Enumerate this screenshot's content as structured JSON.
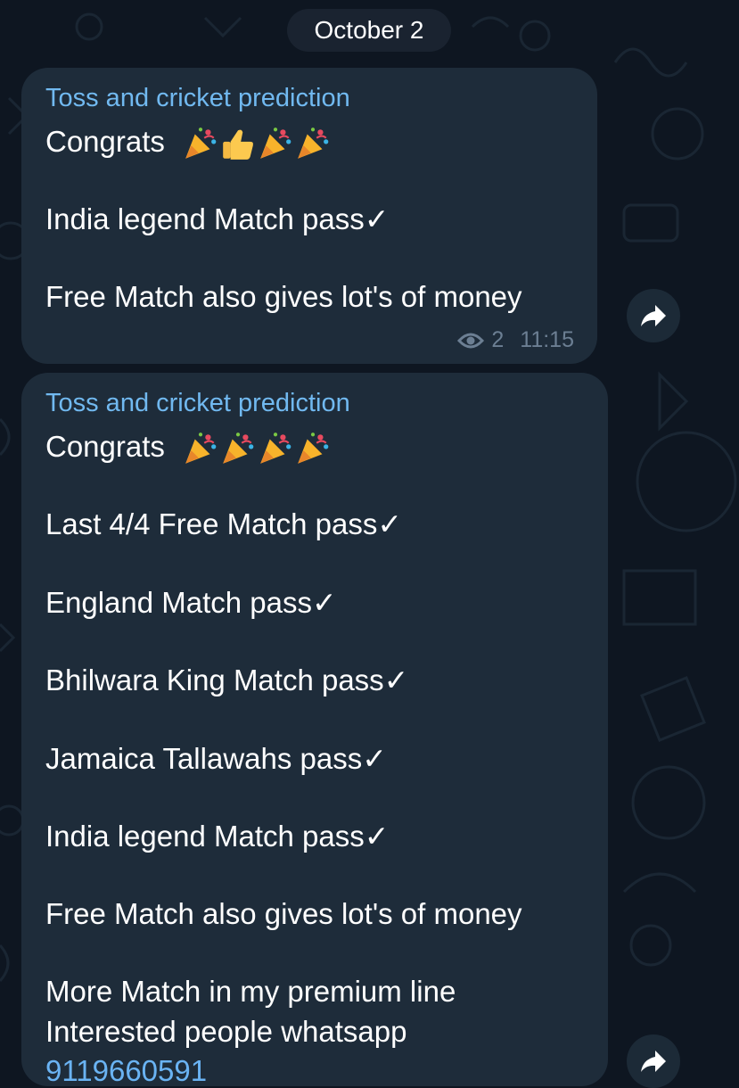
{
  "date_separator": "October 2",
  "messages": [
    {
      "sender": "Toss and cricket prediction",
      "congrats": "Congrats",
      "emojis": [
        "party-popper",
        "thumbs-up",
        "party-popper",
        "party-popper"
      ],
      "lines": [
        "India legend Match pass✓",
        "Free Match also gives lot's of money"
      ],
      "views": "2",
      "time": "11:15"
    },
    {
      "sender": "Toss and cricket prediction",
      "congrats": "Congrats",
      "emojis": [
        "party-popper",
        "party-popper",
        "party-popper",
        "party-popper"
      ],
      "lines": [
        "Last 4/4 Free Match pass✓",
        "England Match pass✓",
        "Bhilwara King Match pass✓",
        "Jamaica Tallawahs pass✓",
        "India legend Match pass✓",
        "Free Match also gives lot's of money",
        "More Match in my premium line",
        "Interested people whatsapp"
      ],
      "phone": "9119660591"
    }
  ],
  "icons": {
    "views": "eye-icon",
    "share": "forward-arrow-icon"
  },
  "colors": {
    "background": "#0e1621",
    "bubble": "#1e2c3a",
    "sender_name": "#71b9f0",
    "meta": "#6c7f93"
  }
}
